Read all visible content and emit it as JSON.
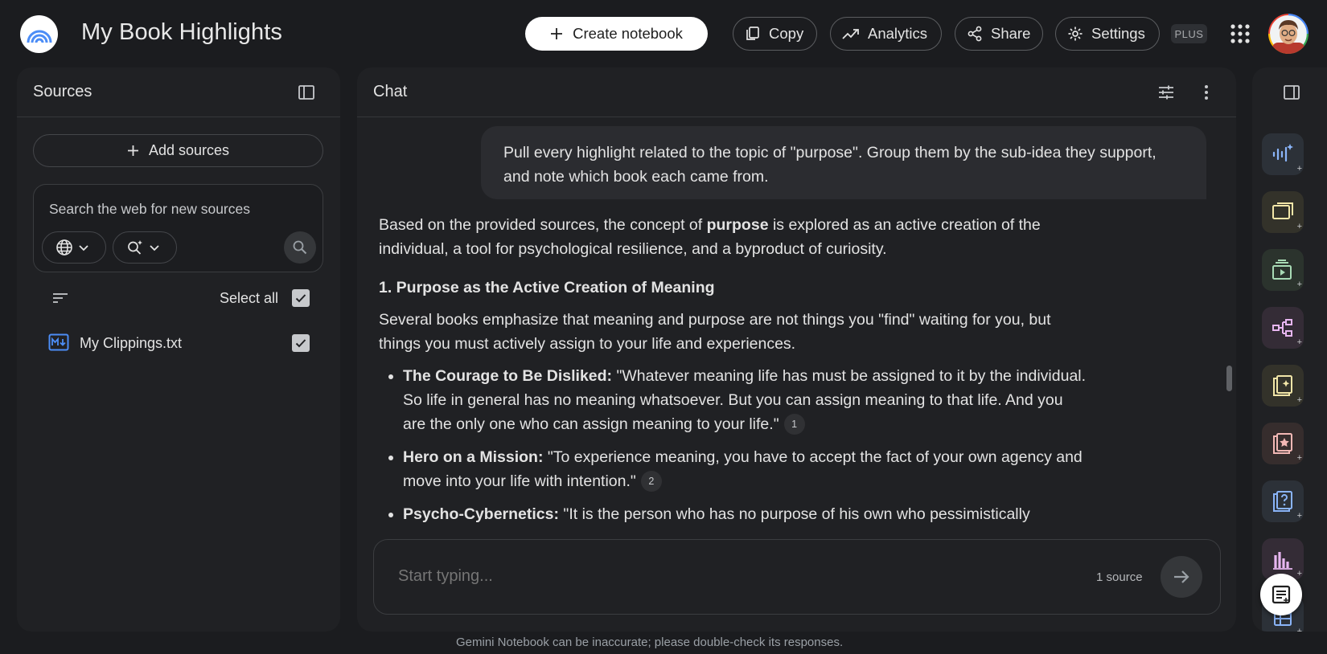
{
  "header": {
    "title": "My Book Highlights",
    "create_label": "Create notebook",
    "copy_label": "Copy",
    "analytics_label": "Analytics",
    "share_label": "Share",
    "settings_label": "Settings",
    "plan_badge": "PLUS"
  },
  "sources": {
    "title": "Sources",
    "add_label": "Add sources",
    "web_search_label": "Search the web for new sources",
    "select_all_label": "Select all",
    "items": [
      {
        "name": "My Clippings.txt",
        "checked": true
      }
    ]
  },
  "chat": {
    "title": "Chat",
    "user_message": "Pull every highlight related to the topic of \"purpose\". Group them by the sub-idea they support, and note which book each came from.",
    "intro_before": "Based on the provided sources, the concept of ",
    "intro_bold": "purpose",
    "intro_after": " is explored as an active creation of the individual, a tool for psychological resilience, and a byproduct of curiosity.",
    "section1_heading": "1. Purpose as the Active Creation of Meaning",
    "section1_body": "Several books emphasize that meaning and purpose are not things you \"find\" waiting for you, but things you must actively assign to your life and experiences.",
    "bullets": [
      {
        "book": "The Courage to Be Disliked:",
        "quote": " \"Whatever meaning life has must be assigned to it by the individual. So life in general has no meaning whatsoever. But you can assign meaning to that life. And you are the only one who can assign meaning to your life.\"",
        "citation": "1"
      },
      {
        "book": "Hero on a Mission:",
        "quote": " \"To experience meaning, you have to accept the fact of your own agency and move into your life with intention.\"",
        "citation": "2"
      },
      {
        "book": "Psycho-Cybernetics:",
        "quote": " \"It is the person who has no purpose of his own who pessimistically",
        "citation": ""
      }
    ],
    "composer_placeholder": "Start typing...",
    "source_count": "1 source"
  },
  "footer": {
    "disclaimer": "Gemini Notebook can be inaccurate; please double-check its responses."
  },
  "colors": {
    "background": "#1b1c1f",
    "panel": "#202124",
    "text": "#e3e3e3",
    "source_icon": "#4c8df6"
  },
  "studio": {
    "tools": [
      {
        "icon": "audio-overview-icon",
        "color": "#8ab4f8",
        "bg": "#2c3138"
      },
      {
        "icon": "slide-deck-icon",
        "color": "#f2e6a8",
        "bg": "#33322a"
      },
      {
        "icon": "video-overview-icon",
        "color": "#a8dab5",
        "bg": "#2b332d"
      },
      {
        "icon": "mind-map-icon",
        "color": "#e7b6f0",
        "bg": "#342c36"
      },
      {
        "icon": "reports-icon",
        "color": "#f2e6a8",
        "bg": "#33322a"
      },
      {
        "icon": "flashcards-icon",
        "color": "#f2b8b5",
        "bg": "#362d2d"
      },
      {
        "icon": "quiz-icon",
        "color": "#8ab4f8",
        "bg": "#2c3138"
      },
      {
        "icon": "infographic-icon",
        "color": "#e7b6f0",
        "bg": "#342c36"
      },
      {
        "icon": "data-table-icon",
        "color": "#8ab4f8",
        "bg": "#2c3138"
      }
    ]
  }
}
